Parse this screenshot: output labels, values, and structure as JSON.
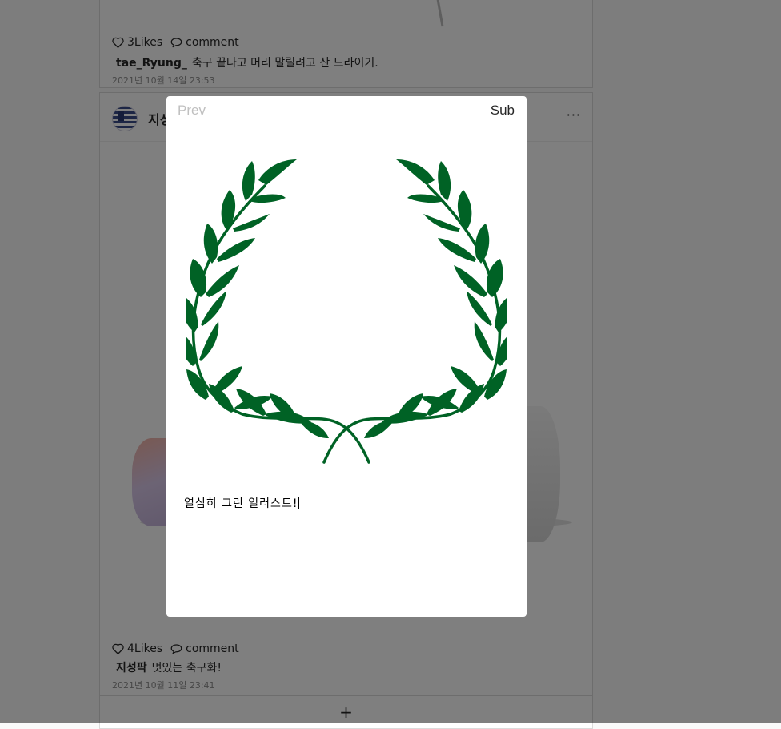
{
  "post_top": {
    "likes": "3Likes",
    "comment_label": "comment",
    "username": "tae_Ryung_",
    "caption": "축구 끝나고 머리 말릴려고 산 드라이기.",
    "date": "2021년 10월 14일 23:53"
  },
  "post_bottom": {
    "header_name": "지성팍",
    "more": "···",
    "likes": "4Likes",
    "comment_label": "comment",
    "username": "지성팍",
    "caption": "멋있는 축구화!",
    "date": "2021년 10월 11일 23:41"
  },
  "add_button": "+",
  "modal": {
    "prev_label": "Prev",
    "sub_label": "Sub",
    "text": "열심히 그린 일러스트!",
    "image_icon": "laurel-wreath-icon",
    "wreath_color": "#006225"
  },
  "colors": {
    "overlay": "rgba(0,0,0,0.5)",
    "prev_disabled": "#c0c0c0"
  }
}
